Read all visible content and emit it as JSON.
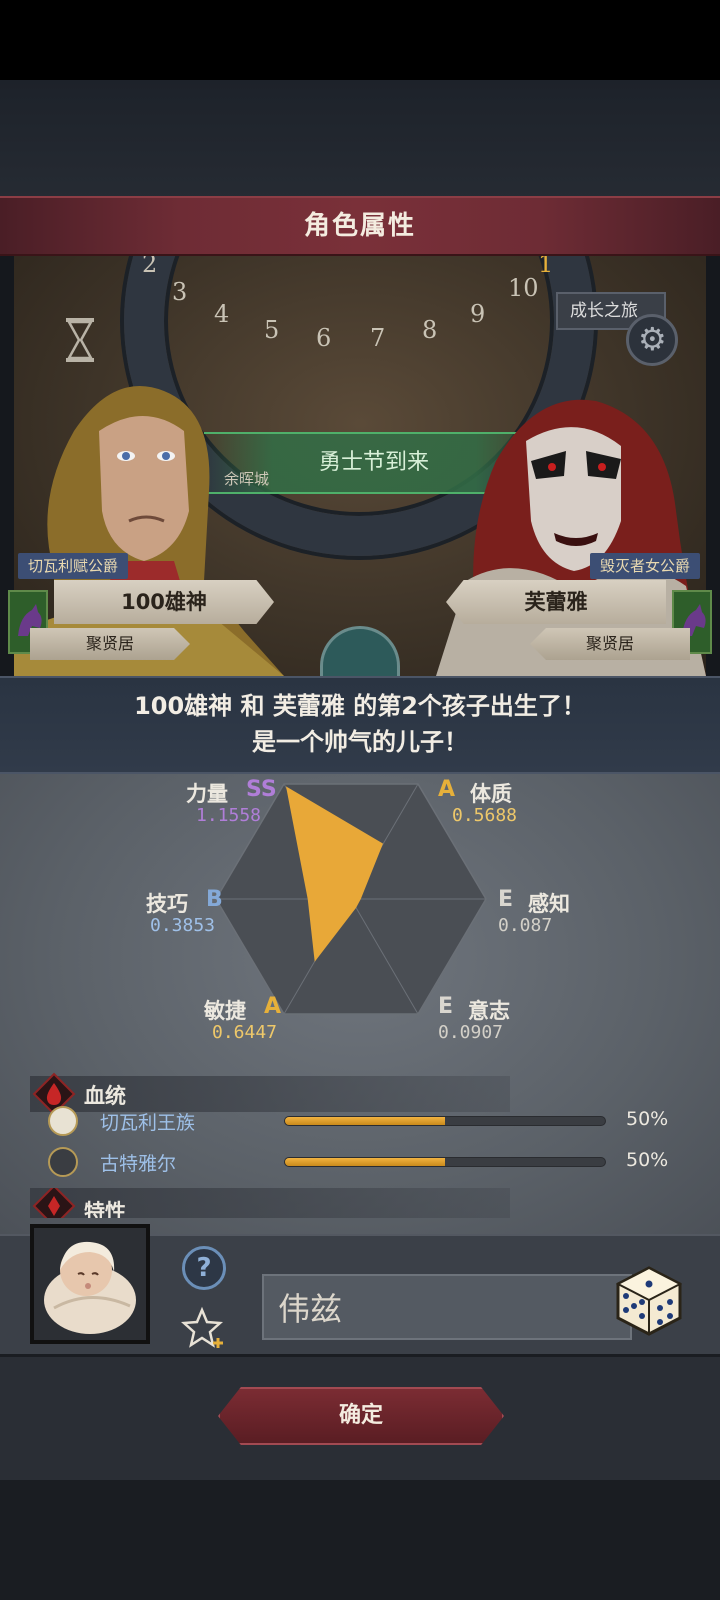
{
  "header": {
    "title": "角色属性"
  },
  "scene": {
    "dial_numbers": [
      "2",
      "3",
      "4",
      "5",
      "6",
      "7",
      "8",
      "9",
      "10",
      "1"
    ],
    "top_right_button": "成长之旅",
    "event_banner": "勇士节到来",
    "location_label": "余晖城"
  },
  "parents": {
    "father": {
      "title": "切瓦利赋公爵",
      "name": "100雄神",
      "residence": "聚贤居"
    },
    "mother": {
      "title": "毁灭者女公爵",
      "name": "芙蕾雅",
      "residence": "聚贤居"
    }
  },
  "message": {
    "line1": "100雄神 和 芙蕾雅 的第2个孩子出生了！",
    "line2": "是一个帅气的儿子！"
  },
  "stats": [
    {
      "key": "strength",
      "name": "力量",
      "grade": "SS",
      "value": "1.1558",
      "grade_color": "#b07ed8",
      "value_color": "#b07ed8"
    },
    {
      "key": "constitution",
      "name": "体质",
      "grade": "A",
      "value": "0.5688",
      "grade_color": "#e6b03a",
      "value_color": "#eec86a"
    },
    {
      "key": "perception",
      "name": "感知",
      "grade": "E",
      "value": "0.087",
      "grade_color": "#d9d6cf",
      "value_color": "#d3d0c8"
    },
    {
      "key": "will",
      "name": "意志",
      "grade": "E",
      "value": "0.0907",
      "grade_color": "#d9d6cf",
      "value_color": "#d3d0c8"
    },
    {
      "key": "agility",
      "name": "敏捷",
      "grade": "A",
      "value": "0.6447",
      "grade_color": "#e6b03a",
      "value_color": "#eec86a"
    },
    {
      "key": "skill",
      "name": "技巧",
      "grade": "B",
      "value": "0.3853",
      "grade_color": "#84a9d8",
      "value_color": "#9fc0e8"
    }
  ],
  "lineage": {
    "title": "血统",
    "items": [
      {
        "name": "切瓦利王族",
        "percent_label": "50%",
        "fraction": 0.5
      },
      {
        "name": "古特雅尔",
        "percent_label": "50%",
        "fraction": 0.5
      }
    ]
  },
  "traits": {
    "title": "特性"
  },
  "naming": {
    "name_value": "伟兹",
    "help_label": "?"
  },
  "footer": {
    "confirm_label": "确定"
  },
  "colors": {
    "accent_red": "#7b2c33",
    "radar_fill": "#e8a838",
    "lineage_bar": "#f2b340"
  }
}
